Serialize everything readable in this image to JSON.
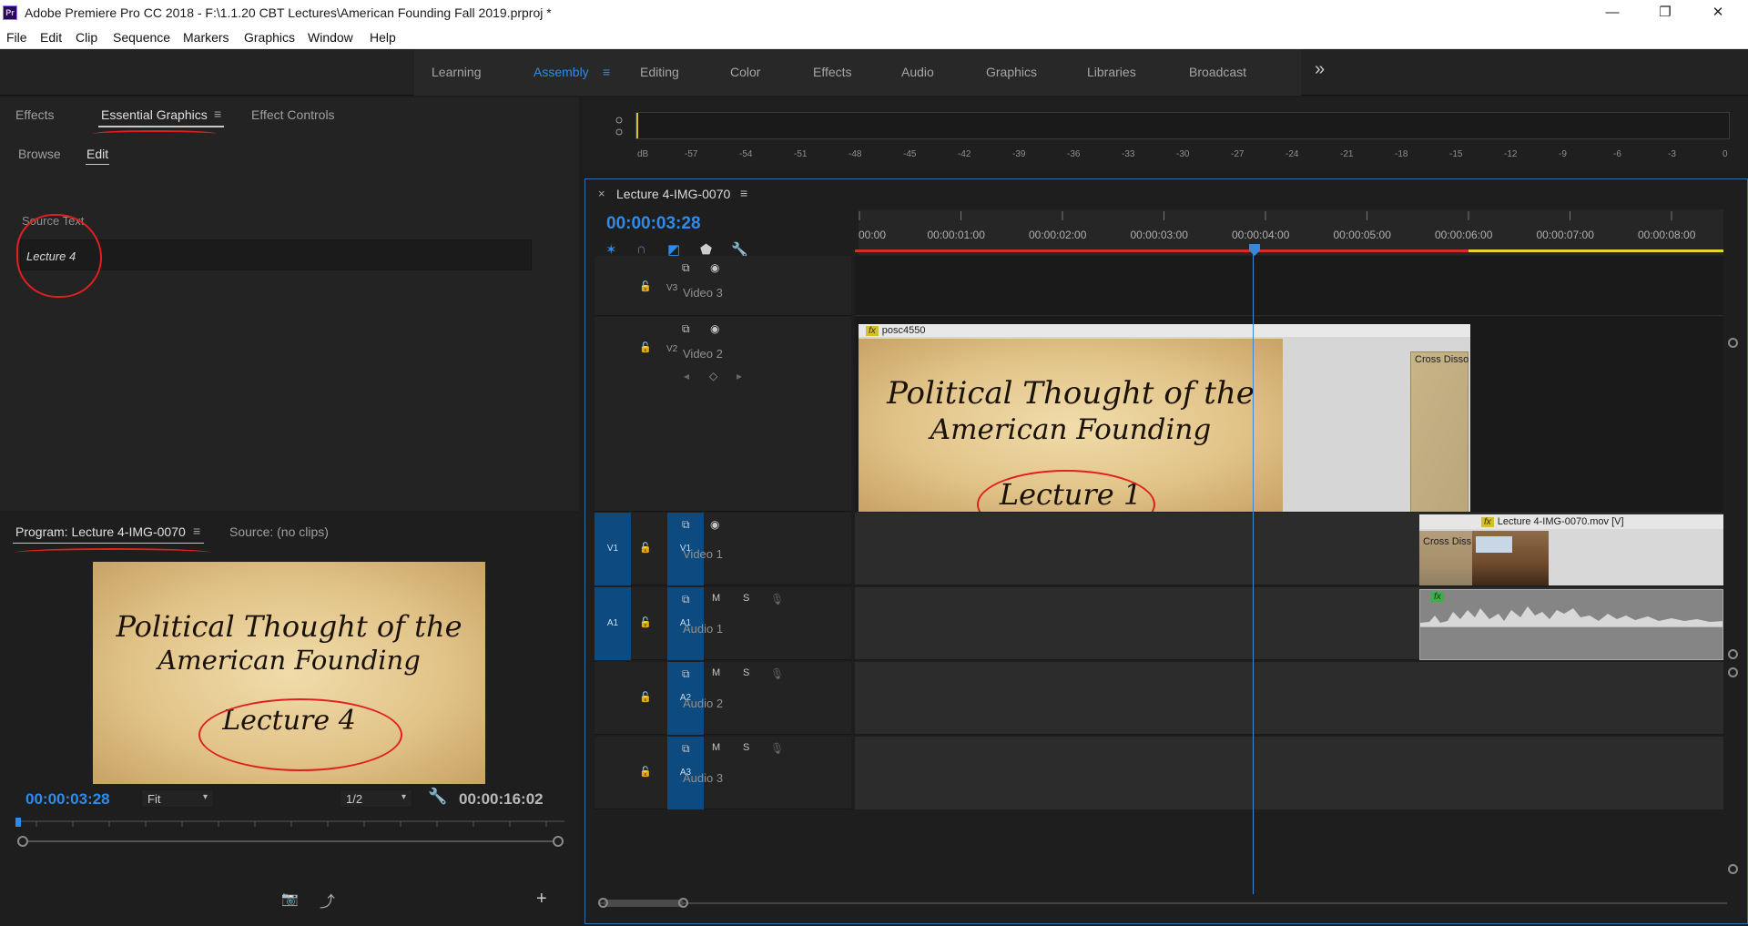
{
  "window": {
    "app_icon": "Pr",
    "title": "Adobe Premiere Pro CC 2018 - F:\\1.1.20 CBT Lectures\\American Founding Fall 2019.prproj *",
    "controls": {
      "minimize": "—",
      "restore": "❐",
      "close": "✕"
    }
  },
  "menu": [
    "File",
    "Edit",
    "Clip",
    "Sequence",
    "Markers",
    "Graphics",
    "Window",
    "Help"
  ],
  "workspaces": {
    "items": [
      "Learning",
      "Assembly",
      "Editing",
      "Color",
      "Effects",
      "Audio",
      "Graphics",
      "Libraries",
      "Broadcast"
    ],
    "active": "Assembly",
    "menu_icon": "≡",
    "more_icon": "»"
  },
  "essential_graphics": {
    "tabs": [
      "Effects",
      "Essential Graphics",
      "Effect Controls"
    ],
    "active_tab": "Essential Graphics",
    "subtabs": [
      "Browse",
      "Edit"
    ],
    "active_subtab": "Edit",
    "source_text_label": "Source Text",
    "source_text_value": "Lecture 4",
    "panel_menu_icon": "≡"
  },
  "program_monitor": {
    "tabs": [
      "Program: Lecture 4-IMG-0070",
      "Source: (no clips)"
    ],
    "active_tab": "Program: Lecture 4-IMG-0070",
    "frame_title_line1": "Political Thought of the",
    "frame_title_line2": "American Founding",
    "frame_lecture": "Lecture 4",
    "current_timecode": "00:00:03:28",
    "zoom": "Fit",
    "resolution": "1/2",
    "duration": "00:00:16:02",
    "camera_icon": "📷",
    "export_icon": "⤴",
    "add_icon": "+"
  },
  "audio_meter": {
    "labels": [
      "dB",
      "-57",
      "-54",
      "-51",
      "-48",
      "-45",
      "-42",
      "-39",
      "-36",
      "-33",
      "-30",
      "-27",
      "-24",
      "-21",
      "-18",
      "-15",
      "-12",
      "-9",
      "-6",
      "-3",
      "0"
    ]
  },
  "timeline": {
    "sequence_name": "Lecture 4-IMG-0070",
    "close_icon": "×",
    "menu_icon": "≡",
    "current_timecode": "00:00:03:28",
    "ruler_labels": [
      "00:00",
      "00:00:01:00",
      "00:00:02:00",
      "00:00:03:00",
      "00:00:04:00",
      "00:00:05:00",
      "00:00:06:00",
      "00:00:07:00",
      "00:00:08:00"
    ],
    "tracks": [
      {
        "id": "V3",
        "name": "Video 3"
      },
      {
        "id": "V2",
        "name": "Video 2"
      },
      {
        "id": "V1",
        "name": "Video 1",
        "source": "V1"
      },
      {
        "id": "A1",
        "name": "Audio 1",
        "source": "A1",
        "mute": "M",
        "solo": "S"
      },
      {
        "id": "A2",
        "name": "Audio 2",
        "mute": "M",
        "solo": "S"
      },
      {
        "id": "A3",
        "name": "Audio 3",
        "mute": "M",
        "solo": "S"
      }
    ],
    "clips": {
      "graphic": "posc4550",
      "graphic_title_line1": "Political Thought of the",
      "graphic_title_line2": "American Founding",
      "graphic_lecture": "Lecture 1",
      "transition_v2": "Cross Disso",
      "transition_v1": "Cross Diss",
      "video": "Lecture 4-IMG-0070.mov [V]",
      "fx_badge": "fx"
    },
    "colors": {
      "accent": "#2d8ceb",
      "work_area": "#e6d431",
      "in_out": "#d62b2b",
      "track_target": "#0d4a7f"
    }
  }
}
